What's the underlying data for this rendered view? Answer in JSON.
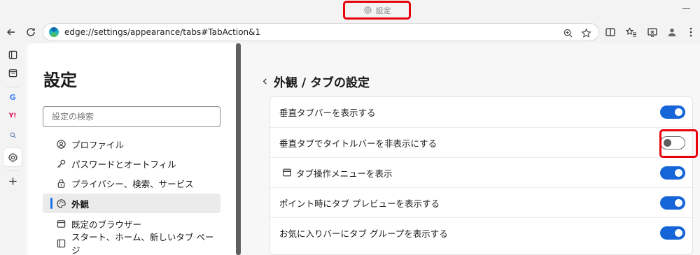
{
  "window": {
    "title": "設定"
  },
  "addressbar": {
    "url": "edge://settings/appearance/tabs#TabAction&1"
  },
  "settings_nav": {
    "title": "設定",
    "search_placeholder": "設定の検索",
    "items": [
      {
        "label": "プロファイル",
        "icon": "profile-icon",
        "active": false
      },
      {
        "label": "パスワードとオートフィル",
        "icon": "key-icon",
        "active": false
      },
      {
        "label": "プライバシー、検索、サービス",
        "icon": "lock-icon",
        "active": false
      },
      {
        "label": "外観",
        "icon": "palette-icon",
        "active": true
      },
      {
        "label": "既定のブラウザー",
        "icon": "browser-icon",
        "active": false
      },
      {
        "label": "スタート、ホーム、新しいタブ ページ",
        "icon": "home-page-icon",
        "active": false
      }
    ]
  },
  "main": {
    "title": "外観 / タブの設定",
    "settings": [
      {
        "label": "垂直タブバーを表示する",
        "on": true
      },
      {
        "label": "垂直タブでタイトルバーを非表示にする",
        "on": false
      },
      {
        "label": "タブ操作メニューを表示",
        "on": true,
        "icon": "window-icon"
      },
      {
        "label": "ポイント時にタブ プレビューを表示する",
        "on": true
      },
      {
        "label": "お気に入りバーにタブ グループを表示する",
        "on": true
      }
    ]
  },
  "colors": {
    "accent": "#1565d8",
    "highlight": "#e8000c"
  }
}
